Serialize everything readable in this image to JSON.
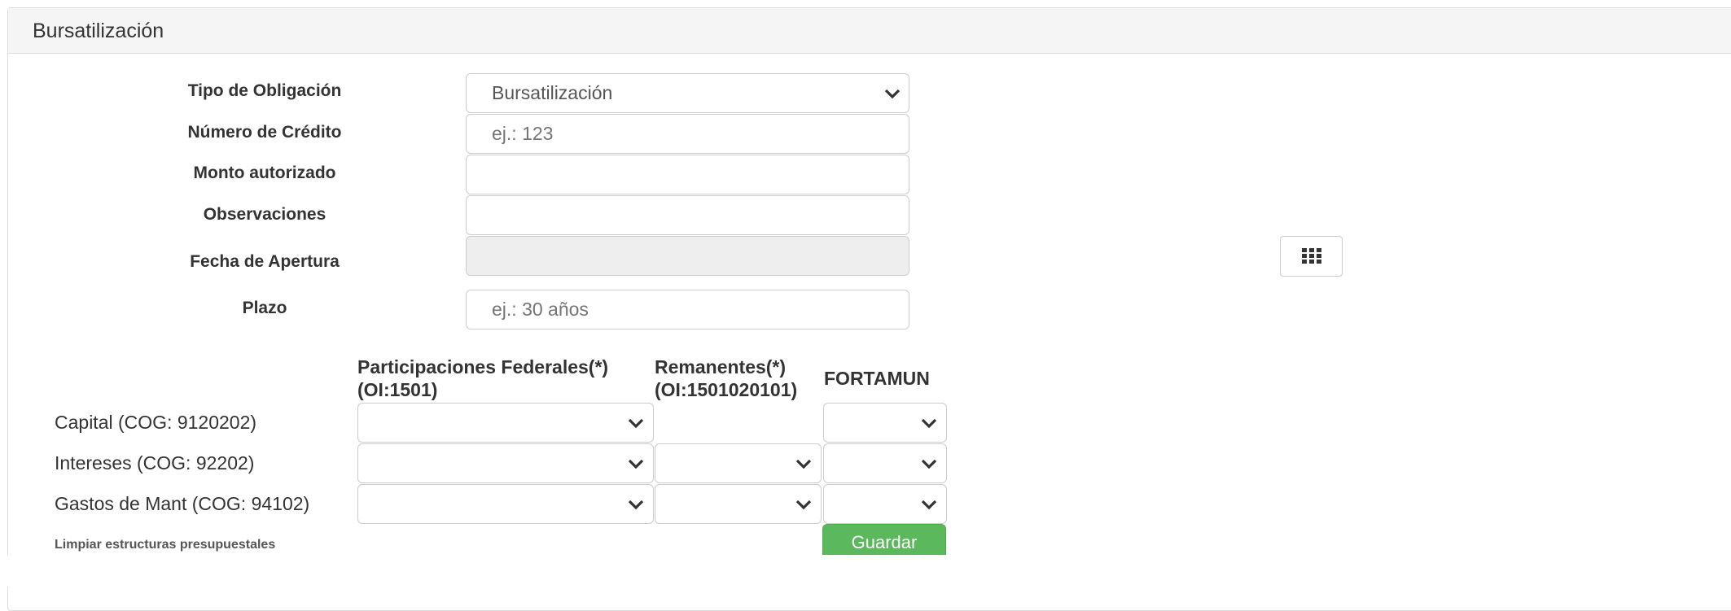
{
  "panel": {
    "title": "Bursatilización"
  },
  "form": {
    "tipo_label": "Tipo de Obligación",
    "tipo_value": "Bursatilización",
    "numero_label": "Número de Crédito",
    "numero_placeholder": "ej.: 123",
    "monto_label": "Monto autorizado",
    "monto_value": "",
    "observaciones_label": "Observaciones",
    "observaciones_value": "",
    "fecha_label": "Fecha de Apertura",
    "fecha_value": "",
    "plazo_label": "Plazo",
    "plazo_placeholder": "ej.: 30 años",
    "calendar_icon": "grid-icon"
  },
  "table": {
    "columns": [
      {
        "line1": "Participaciones Federales(*)",
        "line2": "(OI:1501)"
      },
      {
        "line1": "Remanentes(*)",
        "line2": "(OI:1501020101)"
      },
      {
        "line1": "FORTAMUN",
        "line2": ""
      }
    ],
    "rows": [
      {
        "label": "Capital (COG: 9120202)"
      },
      {
        "label": "Intereses (COG: 92202)"
      },
      {
        "label": "Gastos de Mant (COG: 94102)"
      }
    ]
  },
  "actions": {
    "clear_label": "Limpiar estructuras presupuestales",
    "save_label": "Guardar"
  },
  "colors": {
    "save": "#5cb85c",
    "heading_bg": "#f5f5f5",
    "border": "#cccccc"
  }
}
